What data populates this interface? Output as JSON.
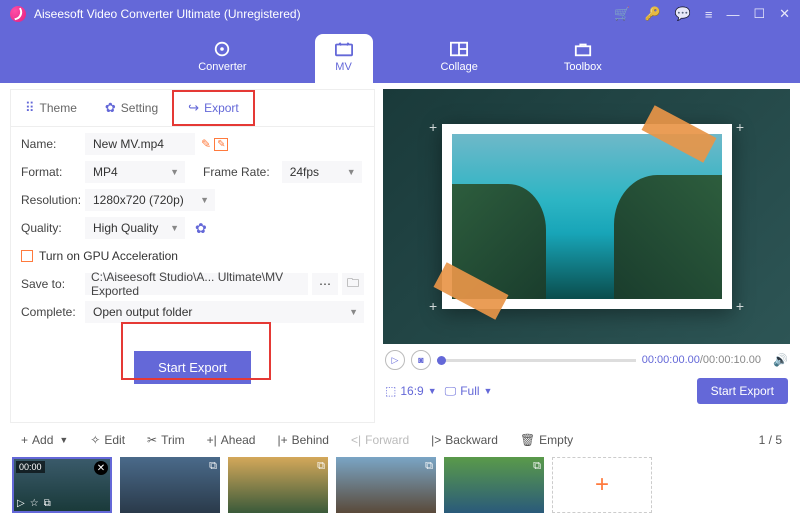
{
  "app": {
    "title": "Aiseesoft Video Converter Ultimate (Unregistered)"
  },
  "nav": {
    "converter": "Converter",
    "mv": "MV",
    "collage": "Collage",
    "toolbox": "Toolbox"
  },
  "tabs": {
    "theme": "Theme",
    "setting": "Setting",
    "export": "Export"
  },
  "form": {
    "name_lbl": "Name:",
    "name_val": "New MV.mp4",
    "format_lbl": "Format:",
    "format_val": "MP4",
    "framerate_lbl": "Frame Rate:",
    "framerate_val": "24fps",
    "resolution_lbl": "Resolution:",
    "resolution_val": "1280x720 (720p)",
    "quality_lbl": "Quality:",
    "quality_val": "High Quality",
    "gpu_lbl": "Turn on GPU Acceleration",
    "saveto_lbl": "Save to:",
    "saveto_val": "C:\\Aiseesoft Studio\\A... Ultimate\\MV Exported",
    "complete_lbl": "Complete:",
    "complete_val": "Open output folder",
    "start_btn": "Start Export"
  },
  "preview": {
    "time_cur": "00:00:00.00",
    "time_dur": "/00:00:10.00",
    "aspect": "16:9",
    "full": "Full",
    "export_btn": "Start Export"
  },
  "toolbar": {
    "add": "Add",
    "edit": "Edit",
    "trim": "Trim",
    "ahead": "Ahead",
    "behind": "Behind",
    "forward": "Forward",
    "backward": "Backward",
    "empty": "Empty",
    "count": "1 / 5"
  },
  "thumbs": {
    "dur1": "00:00",
    "add": "+"
  }
}
